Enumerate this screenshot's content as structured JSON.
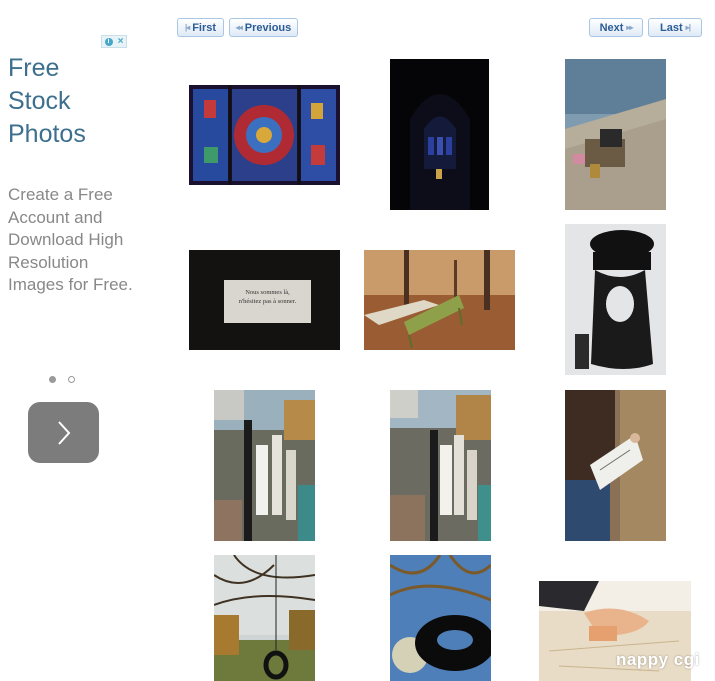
{
  "ad": {
    "title": "Free Stock Photos",
    "body": "Create a Free Account and Download High Resolution Images for Free.",
    "badge_icons": [
      "info-icon",
      "close-icon"
    ],
    "slides_total": 2,
    "slide_active": 1,
    "next_icon": "chevron-right-icon"
  },
  "pager": {
    "first": "First",
    "previous": "Previous",
    "next": "Next",
    "last": "Last"
  },
  "photos": [
    {
      "subject": "stained glass window"
    },
    {
      "subject": "dark cathedral interior"
    },
    {
      "subject": "love locks on stone ledge"
    },
    {
      "subject": "note card",
      "caption_line1": "Nous sommes là,",
      "caption_line2": "n'hésitez pas à sonner."
    },
    {
      "subject": "green park chairs in autumn"
    },
    {
      "subject": "street art poster"
    },
    {
      "subject": "bouquiniste stall"
    },
    {
      "subject": "bouquiniste stall"
    },
    {
      "subject": "man sketching"
    },
    {
      "subject": "tire swing in trees"
    },
    {
      "subject": "tire swing against sky"
    },
    {
      "subject": "hand on map"
    }
  ],
  "watermark": "nappy cgi",
  "colors": {
    "ad_title": "#3d6f8e",
    "ad_body": "#888888",
    "pager_text": "#2c5c96",
    "pager_border": "#a9c6e4"
  }
}
